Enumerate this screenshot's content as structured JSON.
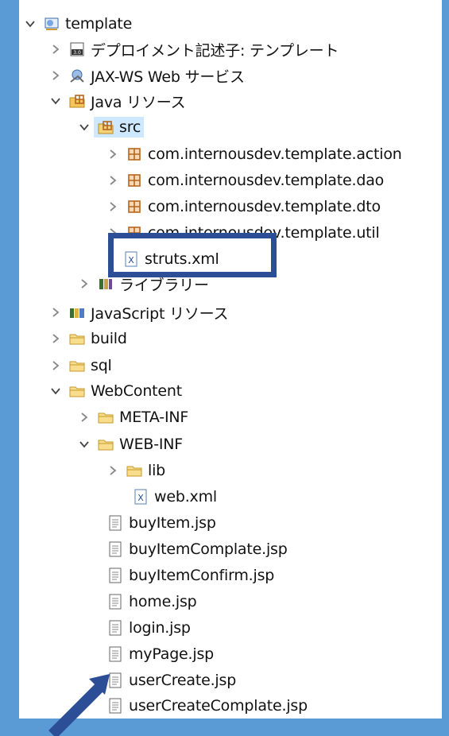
{
  "tree": {
    "root": {
      "label": "template",
      "icon": "web-project-icon"
    },
    "items": [
      {
        "label": "デプロイメント記述子: テンプレート",
        "icon": "deployment-descriptor-icon"
      },
      {
        "label": "JAX-WS Web サービス",
        "icon": "webservice-icon"
      },
      {
        "label": "Java リソース",
        "icon": "java-resources-icon"
      },
      {
        "label": "src",
        "icon": "source-folder-icon",
        "selected": true
      },
      {
        "label": "com.internousdev.template.action",
        "icon": "package-icon"
      },
      {
        "label": "com.internousdev.template.dao",
        "icon": "package-icon"
      },
      {
        "label": "com.internousdev.template.dto",
        "icon": "package-icon"
      },
      {
        "label": "com.internousdev.template.util",
        "icon": "package-icon"
      },
      {
        "label": "struts.xml",
        "icon": "xml-file-icon"
      },
      {
        "label": "ライブラリー",
        "icon": "library-icon"
      },
      {
        "label": "JavaScript リソース",
        "icon": "js-resources-icon"
      },
      {
        "label": "build",
        "icon": "folder-icon"
      },
      {
        "label": "sql",
        "icon": "folder-icon"
      },
      {
        "label": "WebContent",
        "icon": "folder-icon"
      },
      {
        "label": "META-INF",
        "icon": "folder-icon"
      },
      {
        "label": "WEB-INF",
        "icon": "folder-icon"
      },
      {
        "label": "lib",
        "icon": "folder-icon"
      },
      {
        "label": "web.xml",
        "icon": "xml-file-icon"
      },
      {
        "label": "buyItem.jsp",
        "icon": "jsp-file-icon"
      },
      {
        "label": "buyItemComplate.jsp",
        "icon": "jsp-file-icon"
      },
      {
        "label": "buyItemConfirm.jsp",
        "icon": "jsp-file-icon"
      },
      {
        "label": "home.jsp",
        "icon": "jsp-file-icon"
      },
      {
        "label": "login.jsp",
        "icon": "jsp-file-icon"
      },
      {
        "label": "myPage.jsp",
        "icon": "jsp-file-icon"
      },
      {
        "label": "userCreate.jsp",
        "icon": "jsp-file-icon"
      },
      {
        "label": "userCreateComplate.jsp",
        "icon": "jsp-file-icon"
      }
    ]
  },
  "colors": {
    "background": "#5b9bd5",
    "highlight_box": "#2b4e96",
    "selection": "#cde8ff",
    "folder": "#f3c55a",
    "package": "#b5651d"
  }
}
